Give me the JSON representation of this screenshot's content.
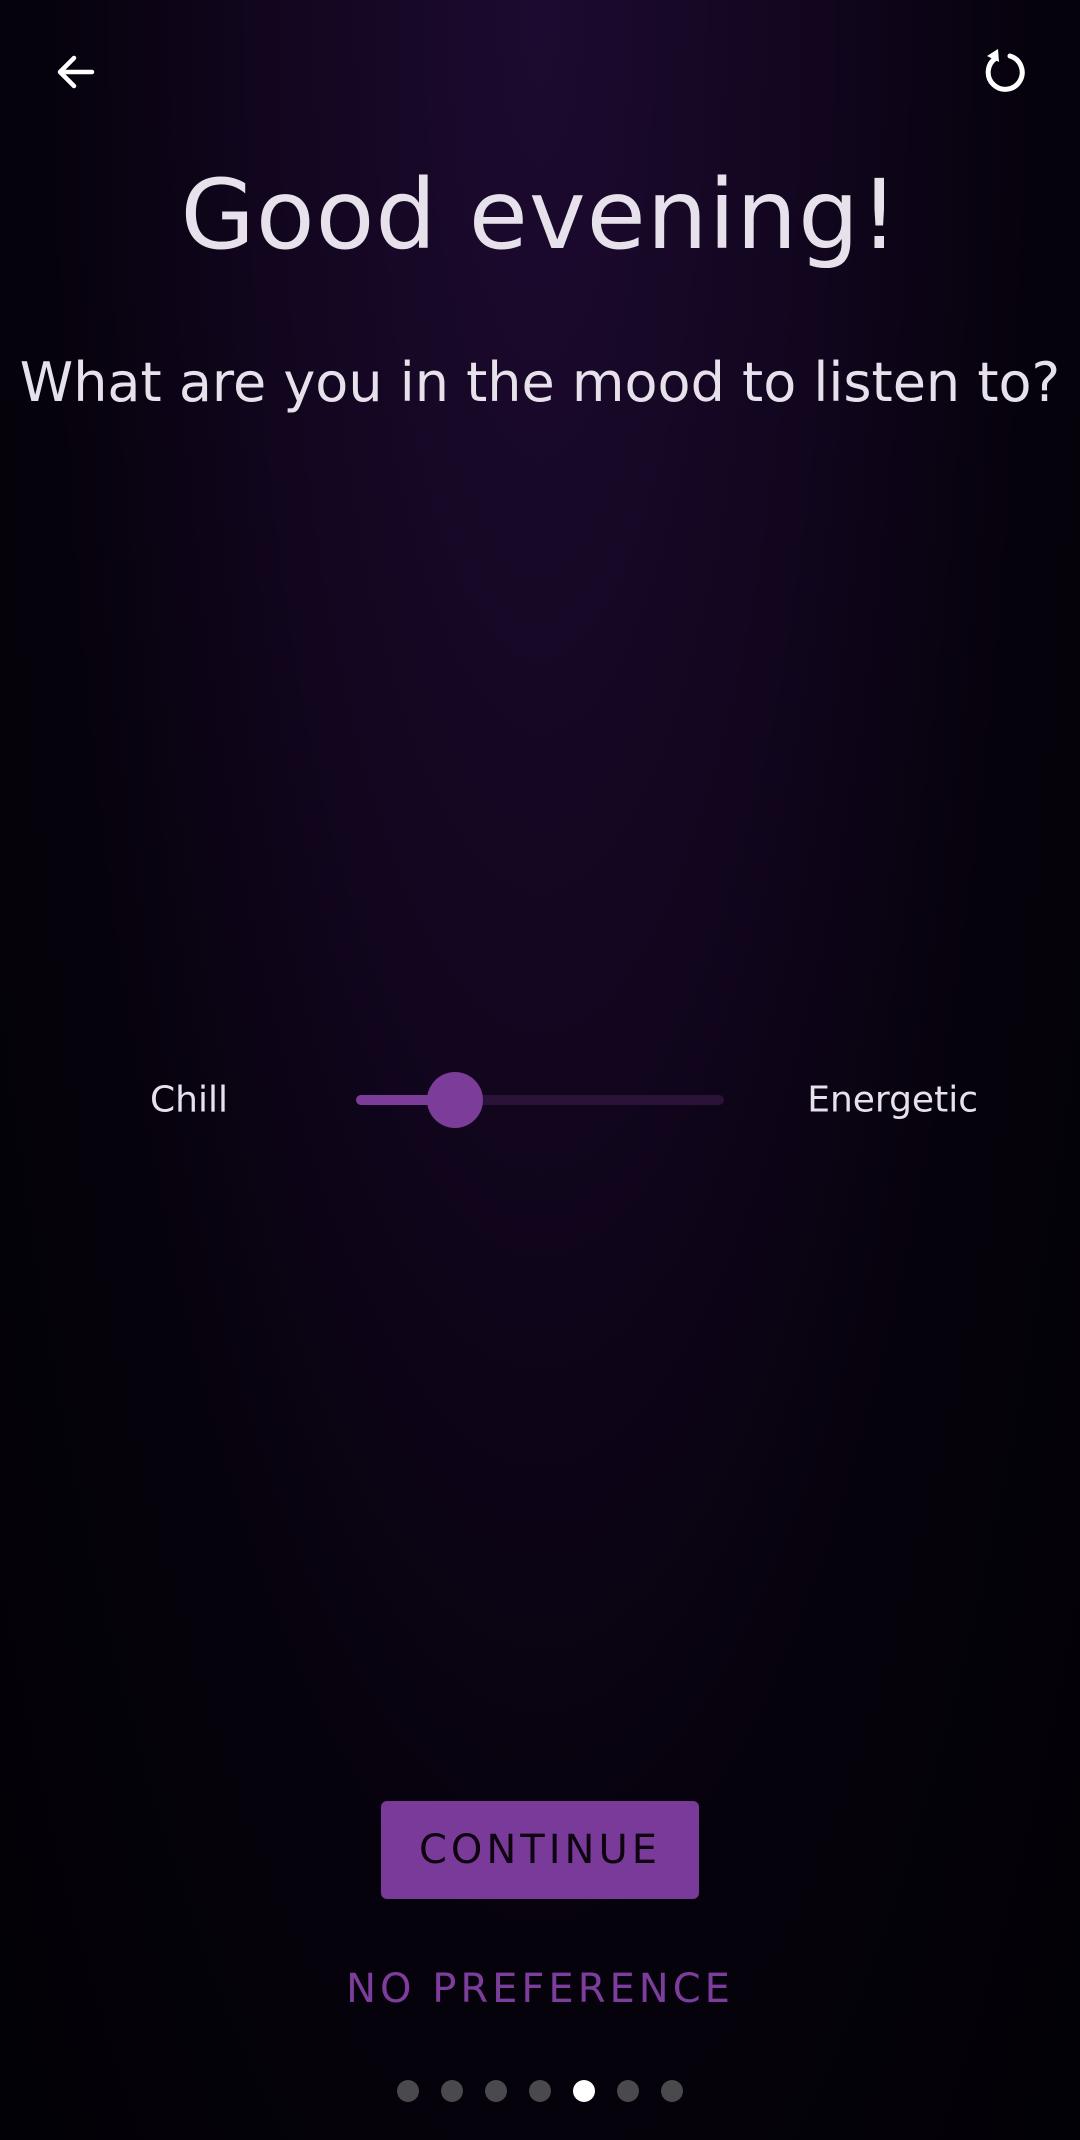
{
  "header": {
    "back_icon": "arrow-left-icon",
    "reset_icon": "refresh-icon"
  },
  "greeting": "Good evening!",
  "question": "What are you in the mood to listen to?",
  "mood_slider": {
    "left_label": "Chill",
    "right_label": "Energetic",
    "value": 0.27
  },
  "continue_label": "CONTINUE",
  "no_preference_label": "NO PREFERENCE",
  "pager": {
    "total": 7,
    "active_index": 4
  },
  "colors": {
    "accent": "#7a3a99",
    "text": "#e6e1ea",
    "dot_inactive": "#4a4a4e",
    "dot_active": "#ffffff"
  }
}
